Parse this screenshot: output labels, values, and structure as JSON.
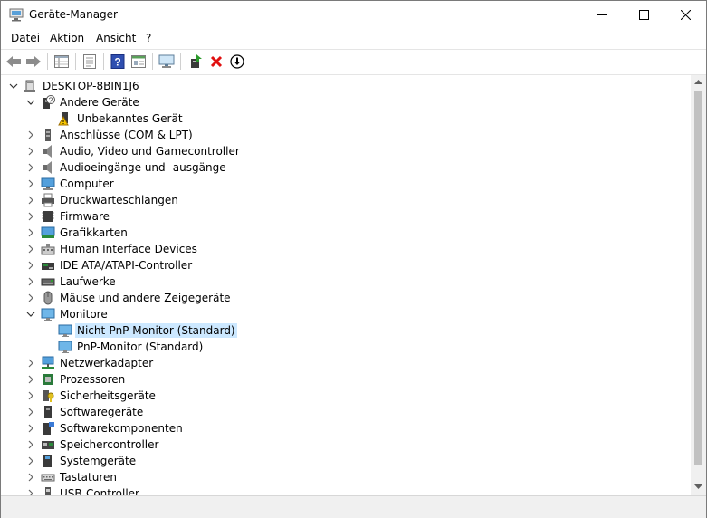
{
  "window": {
    "title": "Geräte-Manager"
  },
  "menu": [
    "Datei",
    "Aktion",
    "Ansicht",
    "?"
  ],
  "menu_underline": [
    "D",
    "k",
    "A",
    "?"
  ],
  "toolbar": {
    "icons": [
      "back-icon",
      "forward-icon",
      "properties-grid-icon",
      "properties-sheet-icon",
      "help-icon",
      "view-icon",
      "monitor-scan-icon",
      "update-driver-icon",
      "uninstall-icon",
      "download-icon"
    ]
  },
  "tree": {
    "root": "DESKTOP-8BIN1J6",
    "items": [
      {
        "label": "Andere Geräte",
        "level": 1,
        "expanded": true,
        "icon": "unknown-device-icon"
      },
      {
        "label": "Unbekanntes Gerät",
        "level": 2,
        "icon": "warning-device-icon"
      },
      {
        "label": "Anschlüsse (COM & LPT)",
        "level": 1,
        "icon": "port-icon"
      },
      {
        "label": "Audio, Video und Gamecontroller",
        "level": 1,
        "icon": "speaker-icon"
      },
      {
        "label": "Audioeingänge und -ausgänge",
        "level": 1,
        "icon": "speaker-icon"
      },
      {
        "label": "Computer",
        "level": 1,
        "icon": "computer-icon"
      },
      {
        "label": "Druckwarteschlangen",
        "level": 1,
        "icon": "printer-icon"
      },
      {
        "label": "Firmware",
        "level": 1,
        "icon": "chip-icon"
      },
      {
        "label": "Grafikkarten",
        "level": 1,
        "icon": "display-adapter-icon"
      },
      {
        "label": "Human Interface Devices",
        "level": 1,
        "icon": "hid-icon"
      },
      {
        "label": "IDE ATA/ATAPI-Controller",
        "level": 1,
        "icon": "ide-icon"
      },
      {
        "label": "Laufwerke",
        "level": 1,
        "icon": "disk-drive-icon"
      },
      {
        "label": "Mäuse und andere Zeigegeräte",
        "level": 1,
        "icon": "mouse-icon"
      },
      {
        "label": "Monitore",
        "level": 1,
        "expanded": true,
        "icon": "monitor-icon"
      },
      {
        "label": "Nicht-PnP Monitor (Standard)",
        "level": 2,
        "selected": true,
        "icon": "monitor-icon"
      },
      {
        "label": "PnP-Monitor (Standard)",
        "level": 2,
        "icon": "monitor-icon"
      },
      {
        "label": "Netzwerkadapter",
        "level": 1,
        "icon": "network-icon"
      },
      {
        "label": "Prozessoren",
        "level": 1,
        "icon": "processor-icon"
      },
      {
        "label": "Sicherheitsgeräte",
        "level": 1,
        "icon": "security-key-icon"
      },
      {
        "label": "Softwaregeräte",
        "level": 1,
        "icon": "software-device-icon"
      },
      {
        "label": "Softwarekomponenten",
        "level": 1,
        "icon": "software-component-icon"
      },
      {
        "label": "Speichercontroller",
        "level": 1,
        "icon": "storage-controller-icon"
      },
      {
        "label": "Systemgeräte",
        "level": 1,
        "icon": "system-device-icon"
      },
      {
        "label": "Tastaturen",
        "level": 1,
        "icon": "keyboard-icon"
      },
      {
        "label": "USB-Controller",
        "level": 1,
        "icon": "usb-icon"
      }
    ]
  },
  "colors": {
    "selection": "#cce8ff",
    "accent": "#0078d7"
  }
}
